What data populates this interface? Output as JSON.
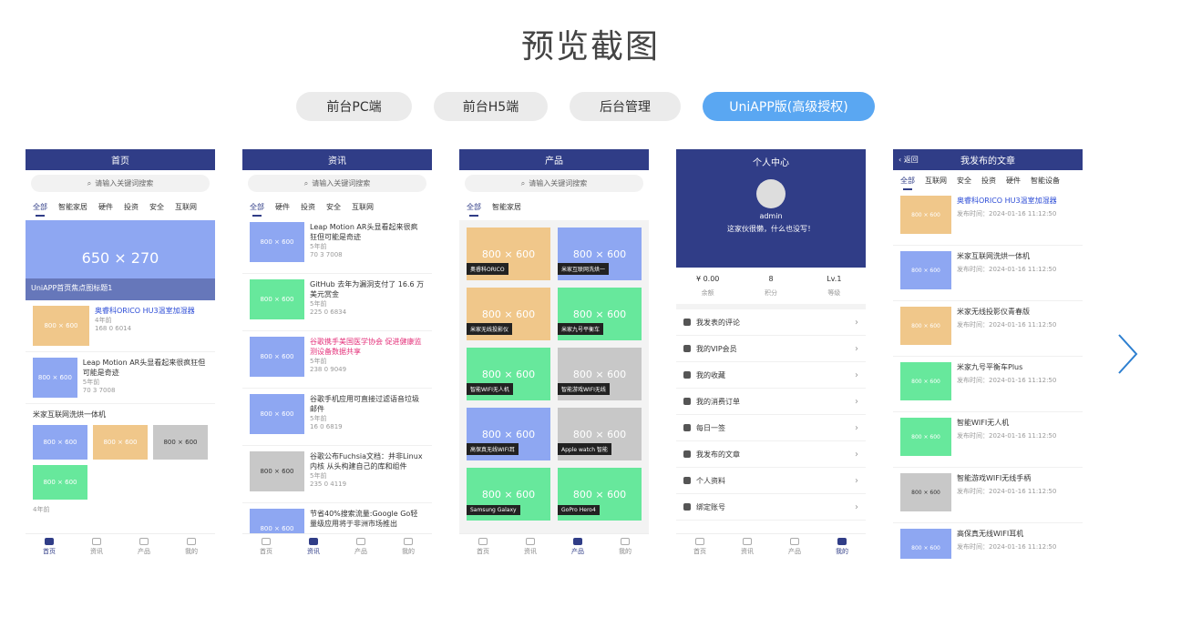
{
  "title": "预览截图",
  "tabs": [
    "前台PC端",
    "前台H5端",
    "后台管理",
    "UniAPP版(高级授权)"
  ],
  "search_placeholder": "请输入关键词搜索",
  "nav": [
    "首页",
    "资讯",
    "产品",
    "我的"
  ],
  "p1": {
    "header": "首页",
    "cats": [
      "全部",
      "智能家居",
      "硬件",
      "投资",
      "安全",
      "互联网"
    ],
    "banner": "650 × 270",
    "banner_caption": "UniAPP首页焦点图标题1",
    "items": [
      {
        "title": "奥睿科ORICO HU3温室加湿器",
        "time": "4年前",
        "stats": "168   0   6014"
      },
      {
        "title": "Leap Motion AR头显看起来很疯狂但可能是奇迹",
        "time": "5年前",
        "stats": "70   3   7008"
      }
    ],
    "group_title": "米家互联网洗烘一体机",
    "group_time": "4年前",
    "img": "800 × 600"
  },
  "p2": {
    "header": "资讯",
    "cats": [
      "全部",
      "硬件",
      "投资",
      "安全",
      "互联网"
    ],
    "items": [
      {
        "title": "Leap Motion AR头显看起来很疯狂但可能是奇迹",
        "time": "5年前",
        "stats": "70   3   7008"
      },
      {
        "title": "GitHub 去年为漏洞支付了 16.6 万美元赏金",
        "time": "5年前",
        "stats": "225   0   6834"
      },
      {
        "title": "谷歌携手美国医学协会 促进健康监测设备数据共享",
        "time": "5年前",
        "stats": "238   0   9049"
      },
      {
        "title": "谷歌手机应用可直接过滤语音垃圾邮件",
        "time": "5年前",
        "stats": "16   0   6819"
      },
      {
        "title": "谷歌公布Fuchsia文档：并非Linux内核 从头构建自己的库和组件",
        "time": "5年前",
        "stats": "235   0   4119"
      },
      {
        "title": "节省40%搜索流量:Google Go轻量级应用将于非洲市场推出",
        "time": "",
        "stats": ""
      }
    ]
  },
  "p3": {
    "header": "产品",
    "cats": [
      "全部",
      "智能家居"
    ],
    "products": [
      "奥睿科ORICO",
      "米家互联网洗烘一",
      "米家无线投影仪",
      "米家九号平衡车",
      "智能WIFI无人机",
      "智能游戏WIFI无线",
      "高保真无线WIFI耳",
      "Apple watch 智能",
      "Samsung Galaxy",
      "GoPro Hero4"
    ]
  },
  "p4": {
    "header": "个人中心",
    "name": "admin",
    "motto": "这家伙很懒，什么也没写！",
    "stats": [
      {
        "v": "¥ 0.00",
        "l": "余额"
      },
      {
        "v": "8",
        "l": "积分"
      },
      {
        "v": "Lv.1",
        "l": "等级"
      }
    ],
    "menu": [
      "我发表的评论",
      "我的VIP会员",
      "我的收藏",
      "我的消费订单",
      "每日一签",
      "我发布的文章",
      "个人资料",
      "绑定账号"
    ]
  },
  "p5": {
    "header": "我发布的文章",
    "back": "返回",
    "cats": [
      "全部",
      "互联网",
      "安全",
      "投资",
      "硬件",
      "智能设备"
    ],
    "items": [
      "奥睿科ORICO HU3温室加湿器",
      "米家互联网洗烘一体机",
      "米家无线投影仪青春版",
      "米家九号平衡车Plus",
      "智能WIFI无人机",
      "智能游戏WIFI无线手柄",
      "高保真无线WIFI耳机"
    ],
    "time": "发布时间：2024-01-16 11:12:50"
  }
}
